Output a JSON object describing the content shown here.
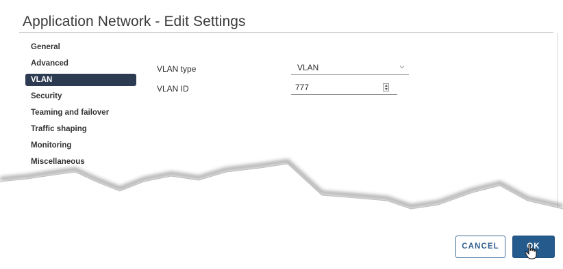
{
  "dialog": {
    "title": "Application Network - Edit Settings"
  },
  "nav": {
    "items": [
      {
        "label": "General",
        "active": false
      },
      {
        "label": "Advanced",
        "active": false
      },
      {
        "label": "VLAN",
        "active": true
      },
      {
        "label": "Security",
        "active": false
      },
      {
        "label": "Teaming and failover",
        "active": false
      },
      {
        "label": "Traffic shaping",
        "active": false
      },
      {
        "label": "Monitoring",
        "active": false
      },
      {
        "label": "Miscellaneous",
        "active": false
      }
    ]
  },
  "vlan": {
    "type_label": "VLAN type",
    "type_value": "VLAN",
    "id_label": "VLAN ID",
    "id_value": "777"
  },
  "buttons": {
    "cancel": "CANCEL",
    "ok": "OK"
  },
  "colors": {
    "active_nav": "#2c3a52",
    "primary": "#245a8c"
  }
}
